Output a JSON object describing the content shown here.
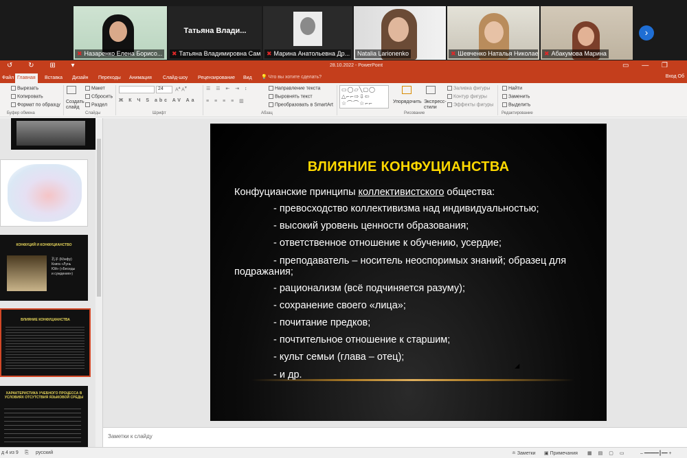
{
  "zoom": {
    "participants": [
      {
        "name": "Назаренко Елена Борисо...",
        "muted": true,
        "active": true
      },
      {
        "name": "Татьяна Владимировна Сам...",
        "display_name": "Татьяна  Влади...",
        "muted": true
      },
      {
        "name": "Марина Анатольевна Др...",
        "muted": true
      },
      {
        "name": "Natalia Larionenko",
        "muted": false
      },
      {
        "name": "Шевченко Наталья Николае...",
        "muted": true
      },
      {
        "name": "Абакумова Марина",
        "muted": true
      }
    ],
    "next_label": "›"
  },
  "app": {
    "title": "28.10.2022 - PowerPoint",
    "quick_access": "↺ ↻ ⊞ ▾",
    "window_buttons": "▭ — ❐",
    "tabs": [
      "Файл",
      "Главная",
      "Вставка",
      "Дизайн",
      "Переходы",
      "Анимация",
      "Слайд-шоу",
      "Рецензирование",
      "Вид"
    ],
    "active_tab": "Главная",
    "tell_me": "Что вы хотите сделать?",
    "right_items": "Вход   Об"
  },
  "ribbon": {
    "cut": "Вырезать",
    "copy": "Копировать",
    "format_painter": "Формат по образцу",
    "clipboard_group": "Буфер обмена",
    "layout": "Макет",
    "reset": "Сбросить",
    "section": "Раздел",
    "new_slide": "Создать слайд",
    "slides_group": "Слайды",
    "font_size": "24",
    "font_group": "Шрифт",
    "text_direction": "Направление текста",
    "align_text": "Выровнять текст",
    "smartart": "Преобразовать в SmartArt",
    "paragraph_group": "Абзац",
    "arrange": "Упорядочить",
    "quick_styles": "Экспресс-стили",
    "shape_fill": "Заливка фигуры",
    "shape_outline": "Контур фигуры",
    "shape_effects": "Эффекты фигуры",
    "drawing_group": "Рисование",
    "find": "Найти",
    "replace": "Заменить",
    "select": "Выделить",
    "editing_group": "Редактирование"
  },
  "thumbnails": {
    "t3_title": "КОНФУЦИЙ И КОНФУЦИАНСТВО",
    "t3_items": [
      "孔子 (Кōнфу)",
      "Книга «Лунь",
      "Юй» («Беседы",
      "и суждения»)"
    ],
    "t4_title": "ВЛИЯНИЕ КОНФУЦИАНСТВА",
    "t5_title": "ХАРАКТЕРИСТИКА УЧЕБНОГО ПРОЦЕССА В УСЛОВИЯХ ОТСУТСТВИЯ ЯЗЫКОВОЙ СРЕДЫ"
  },
  "slide": {
    "title": "ВЛИЯНИЕ КОНФУЦИАНСТВА",
    "intro_before": "Конфуцианские принципы ",
    "intro_underlined": "коллективистского",
    "intro_after": " общества:",
    "bullets": [
      "- превосходство коллективизма над индивидуальностью;",
      "- высокий уровень ценности образования;",
      "- ответственное отношение к обучению, усердие;",
      "- преподаватель – носитель неоспоримых знаний; образец для",
      "- рационализм (всё подчиняется разуму);",
      "- сохранение своего «лица»;",
      "- почитание предков;",
      "- почтительное отношение к старшим;",
      "- культ семьи (глава – отец);",
      "- и др."
    ],
    "bullet4_cont": "подражания;"
  },
  "notes": {
    "placeholder": "Заметки к слайду"
  },
  "status": {
    "slide_count": "д 4 из 9",
    "language": "русский",
    "notes_btn": "Заметки",
    "comments_btn": "Примечания"
  },
  "colors": {
    "ppt_accent": "#c43e1c",
    "slide_title": "#ffd800",
    "zoom_active": "#9bd22a"
  }
}
